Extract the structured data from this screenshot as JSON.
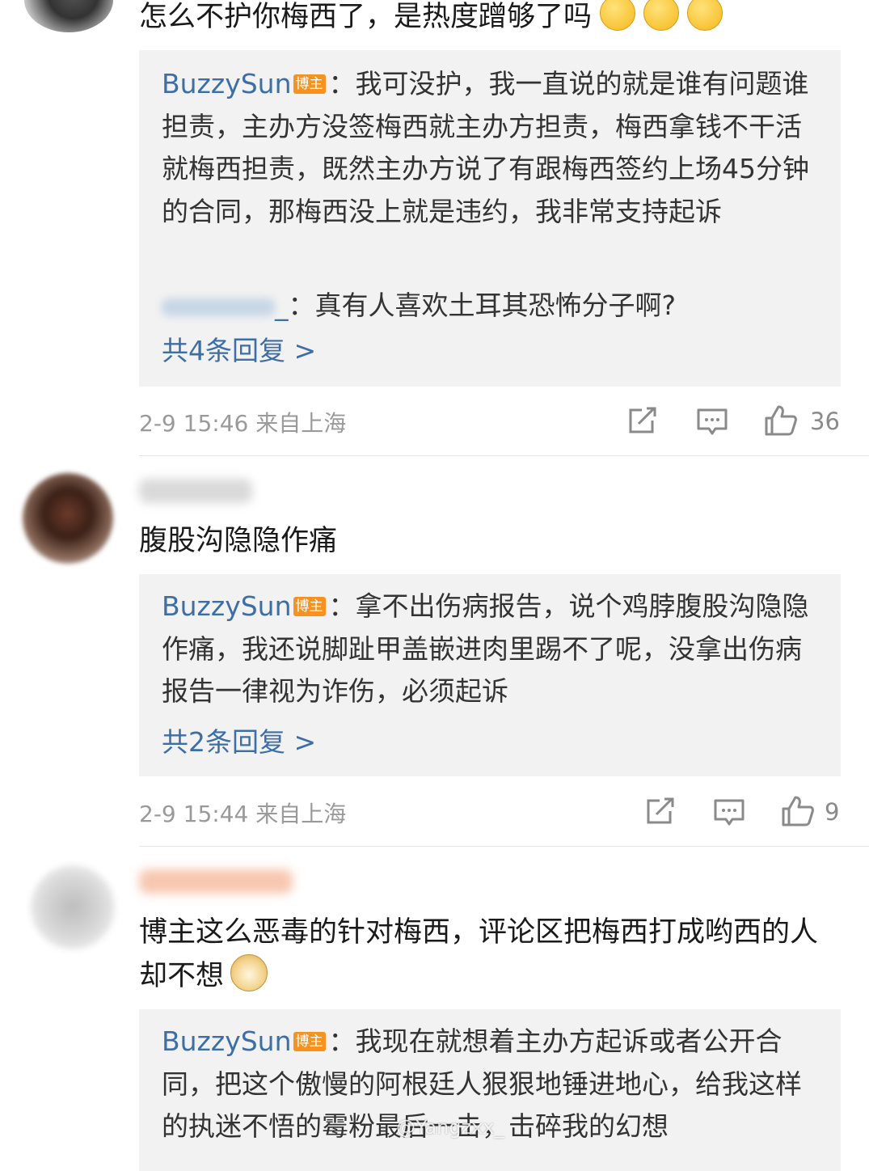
{
  "comments": [
    {
      "text": "怎么不护你梅西了，是热度蹭够了吗",
      "emoji_count": 3,
      "reply_author": "BuzzySun",
      "reply_badge": "博主",
      "reply_text": "：我可没护，我一直说的就是谁有问题谁担责，主办方没签梅西就主办方担责，梅西拿钱不干活就梅西担责，既然主办方说了有跟梅西签约上场45分钟的合同，那梅西没上就是违约，我非常支持起诉",
      "subreply_suffix": "_",
      "subreply_text": "：真有人喜欢土耳其恐怖分子啊?",
      "more_replies": "共4条回复 >",
      "timestamp": "2-9 15:46",
      "location": "来自上海",
      "like_count": "36"
    },
    {
      "text": "腹股沟隐隐作痛",
      "reply_author": "BuzzySun",
      "reply_badge": "博主",
      "reply_text": "：拿不出伤病报告，说个鸡脖腹股沟隐隐作痛，我还说脚趾甲盖嵌进肉里踢不了呢，没拿出伤病报告一律视为诈伤，必须起诉",
      "more_replies": "共2条回复 >",
      "timestamp": "2-9 15:44",
      "location": "来自上海",
      "like_count": "9"
    },
    {
      "text": "博主这么恶毒的针对梅西，评论区把梅西打成哟西的人却不想",
      "reply_author": "BuzzySun",
      "reply_badge": "博主",
      "reply_text": "：我现在就想着主办方起诉或者公开合同，把这个傲慢的阿根廷人狠狠地锤进地心，给我这样的执迷不悟的霉粉最后一击，击碎我的幻想"
    }
  ],
  "icons": {
    "share": "share-icon",
    "comment": "comment-icon",
    "like": "like-icon",
    "emoji": "thinking-face-emoji",
    "doge": "doge-emoji"
  },
  "colors": {
    "link": "#3d6fa6",
    "badge": "#f6931f",
    "reply_bg": "#f2f2f2",
    "meta": "#9a9a9a"
  },
  "watermark": "@Yangzxx_"
}
